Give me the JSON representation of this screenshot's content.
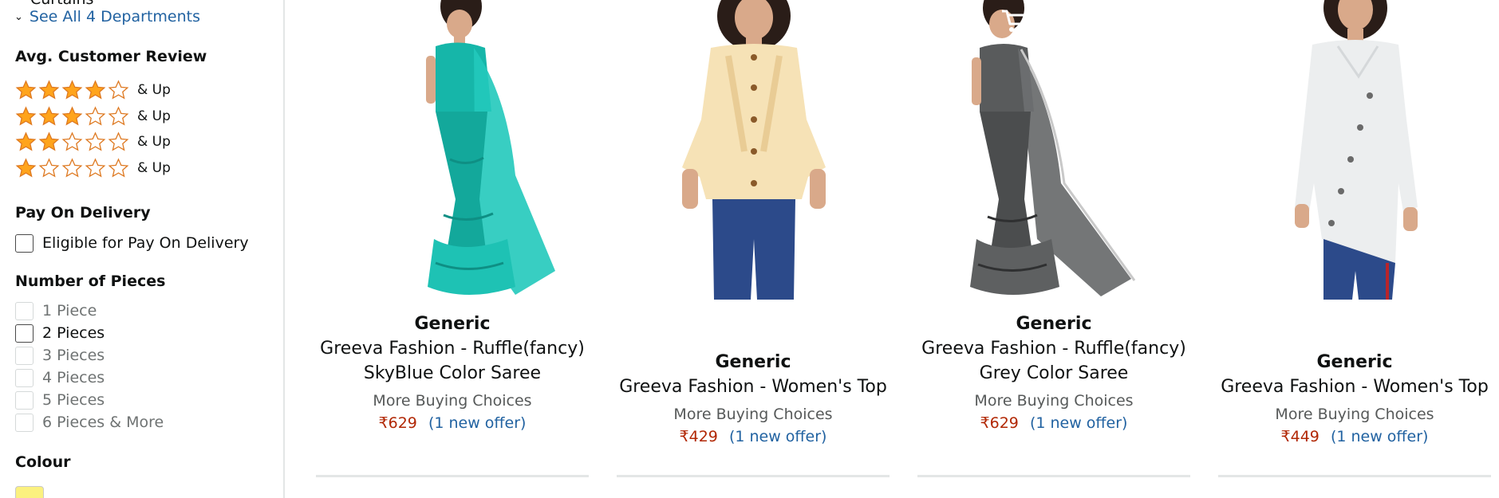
{
  "sidebar": {
    "prev_item": "Curtains",
    "see_all": "See All 4 Departments",
    "review_heading": "Avg. Customer Review",
    "ratings": [
      {
        "stars": 4,
        "label": "& Up"
      },
      {
        "stars": 3,
        "label": "& Up"
      },
      {
        "stars": 2,
        "label": "& Up"
      },
      {
        "stars": 1,
        "label": "& Up"
      }
    ],
    "pod_heading": "Pay On Delivery",
    "pod_option": "Eligible for Pay On Delivery",
    "pieces_heading": "Number of Pieces",
    "pieces": [
      "1 Piece",
      "2 Pieces",
      "3 Pieces",
      "4 Pieces",
      "5 Pieces",
      "6 Pieces & More"
    ],
    "colour_heading": "Colour",
    "colour_swatch": "#fbf17f"
  },
  "cart_overlay": "Ca",
  "products": [
    {
      "brand": "Generic",
      "title_line1": "Greeva Fashion - Ruffle(fancy)",
      "title_line2": "SkyBlue Color Saree",
      "more": "More Buying Choices",
      "price": "₹629",
      "offer": "(1 new offer)"
    },
    {
      "brand": "Generic",
      "title_line1": "Greeva Fashion - Women's Top",
      "more": "More Buying Choices",
      "price": "₹429",
      "offer": "(1 new offer)"
    },
    {
      "brand": "Generic",
      "title_line1": "Greeva Fashion - Ruffle(fancy)",
      "title_line2": "Grey Color Saree",
      "more": "More Buying Choices",
      "price": "₹629",
      "offer": "(1 new offer)"
    },
    {
      "brand": "Generic",
      "title_line1": "Greeva Fashion - Women's Top",
      "more": "More Buying Choices",
      "price": "₹449",
      "offer": "(1 new offer)"
    }
  ],
  "colors": {
    "link": "#2162a1",
    "price": "#b12704",
    "star": "#ffa41c"
  }
}
